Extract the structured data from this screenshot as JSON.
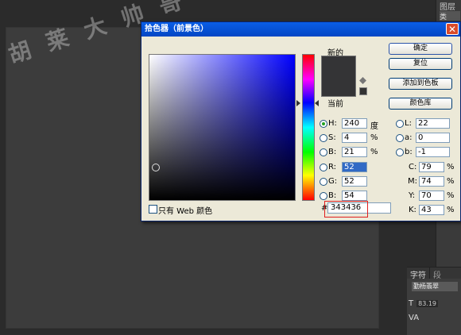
{
  "panels": {
    "layers_tab": "图层",
    "layers_chip": "类",
    "character_tab": "字符",
    "paragraph_tab": "段",
    "font_name": "勤杨翡翠",
    "font_size_value": "83.19",
    "tracking_label": "VA"
  },
  "watermark": "胡 莱 大 帅 哥",
  "dialog": {
    "title": "拾色器（前景色）",
    "new_label": "新的",
    "current_label": "当前",
    "buttons": {
      "ok": "确定",
      "reset": "复位",
      "add_swatch": "添加到色板",
      "libraries": "颜色库"
    },
    "hsb": {
      "h": {
        "label": "H:",
        "value": "240",
        "unit": "度"
      },
      "s": {
        "label": "S:",
        "value": "4",
        "unit": "%"
      },
      "b": {
        "label": "B:",
        "value": "21",
        "unit": "%"
      }
    },
    "rgb": {
      "r": {
        "label": "R:",
        "value": "52"
      },
      "g": {
        "label": "G:",
        "value": "52"
      },
      "b": {
        "label": "B:",
        "value": "54"
      }
    },
    "lab": {
      "l": {
        "label": "L:",
        "value": "22"
      },
      "a": {
        "label": "a:",
        "value": "0"
      },
      "b": {
        "label": "b:",
        "value": "-1"
      }
    },
    "cmyk": {
      "c": {
        "label": "C:",
        "value": "79",
        "unit": "%"
      },
      "m": {
        "label": "M:",
        "value": "74",
        "unit": "%"
      },
      "y": {
        "label": "Y:",
        "value": "70",
        "unit": "%"
      },
      "k": {
        "label": "K:",
        "value": "43",
        "unit": "%"
      }
    },
    "hex_label": "#",
    "hex_value": "343436",
    "web_only_label": "只有 Web 颜色",
    "colors": {
      "picked": "#343436",
      "hue_base": "#0000ff"
    }
  }
}
